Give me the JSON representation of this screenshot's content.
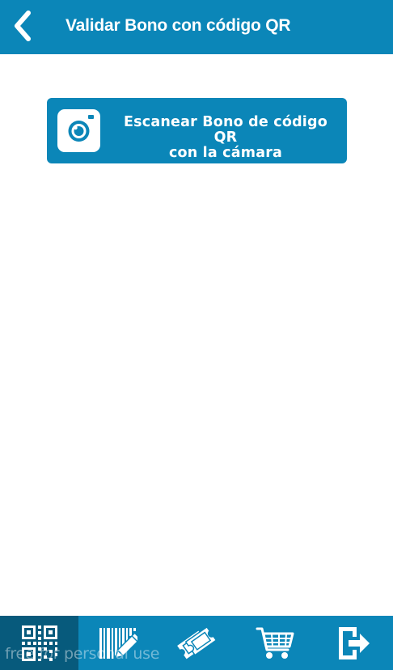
{
  "header": {
    "title": "Validar Bono con código QR",
    "back_icon": "chevron-left-icon",
    "background": "#0b86b8"
  },
  "main": {
    "scan_button": {
      "line1": "Escanear Bono de código QR",
      "line2": "con la cámara",
      "icon": "camera-icon"
    }
  },
  "tabbar": {
    "background": "#0b86b8",
    "active_background": "#075a7c",
    "tabs": [
      {
        "icon": "qr-code-icon",
        "active": true
      },
      {
        "icon": "barcode-edit-icon",
        "active": false
      },
      {
        "icon": "tickets-icon",
        "active": false
      },
      {
        "icon": "shopping-cart-icon",
        "active": false
      },
      {
        "icon": "logout-icon",
        "active": false
      }
    ]
  },
  "watermark": "free for personal use"
}
